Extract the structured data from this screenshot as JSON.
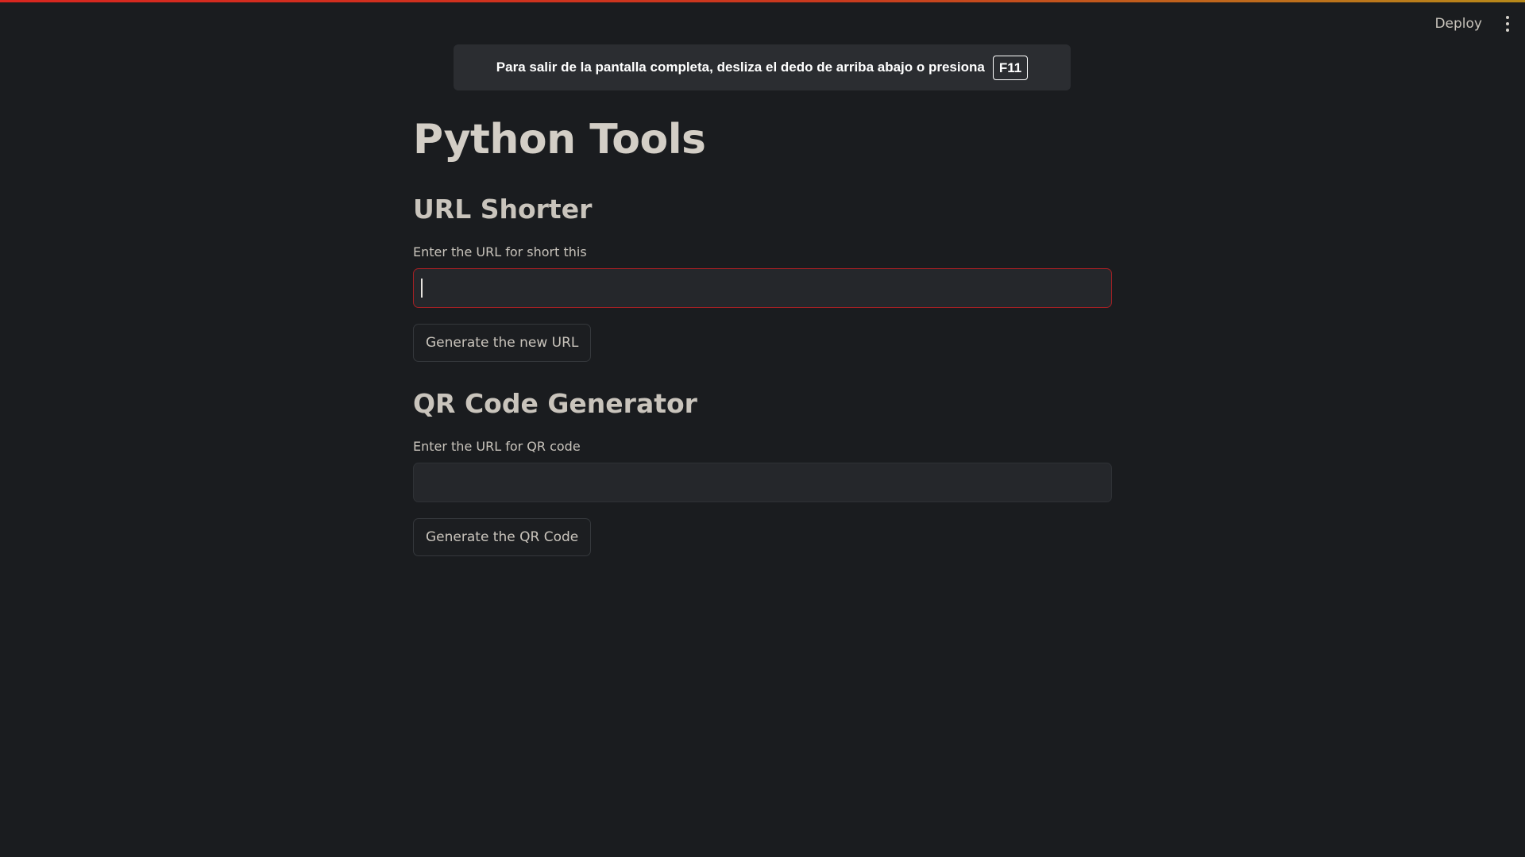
{
  "header": {
    "deploy_label": "Deploy",
    "menu_icon": "vertical-ellipsis-icon"
  },
  "banner": {
    "message": "Para salir de la pantalla completa, desliza el dedo de arriba abajo o presiona",
    "key": "F11"
  },
  "page": {
    "title": "Python Tools"
  },
  "url_shorter": {
    "title": "URL Shorter",
    "input_label": "Enter the URL for short this",
    "input_value": "",
    "button_label": "Generate the new URL"
  },
  "qr_generator": {
    "title": "QR Code Generator",
    "input_label": "Enter the URL for QR code",
    "input_value": "",
    "button_label": "Generate the QR Code"
  },
  "colors": {
    "background": "#1a1c1f",
    "focus_border": "#a32024",
    "top_stripe_start": "#d8261f",
    "top_stripe_end": "#b88a1a"
  }
}
